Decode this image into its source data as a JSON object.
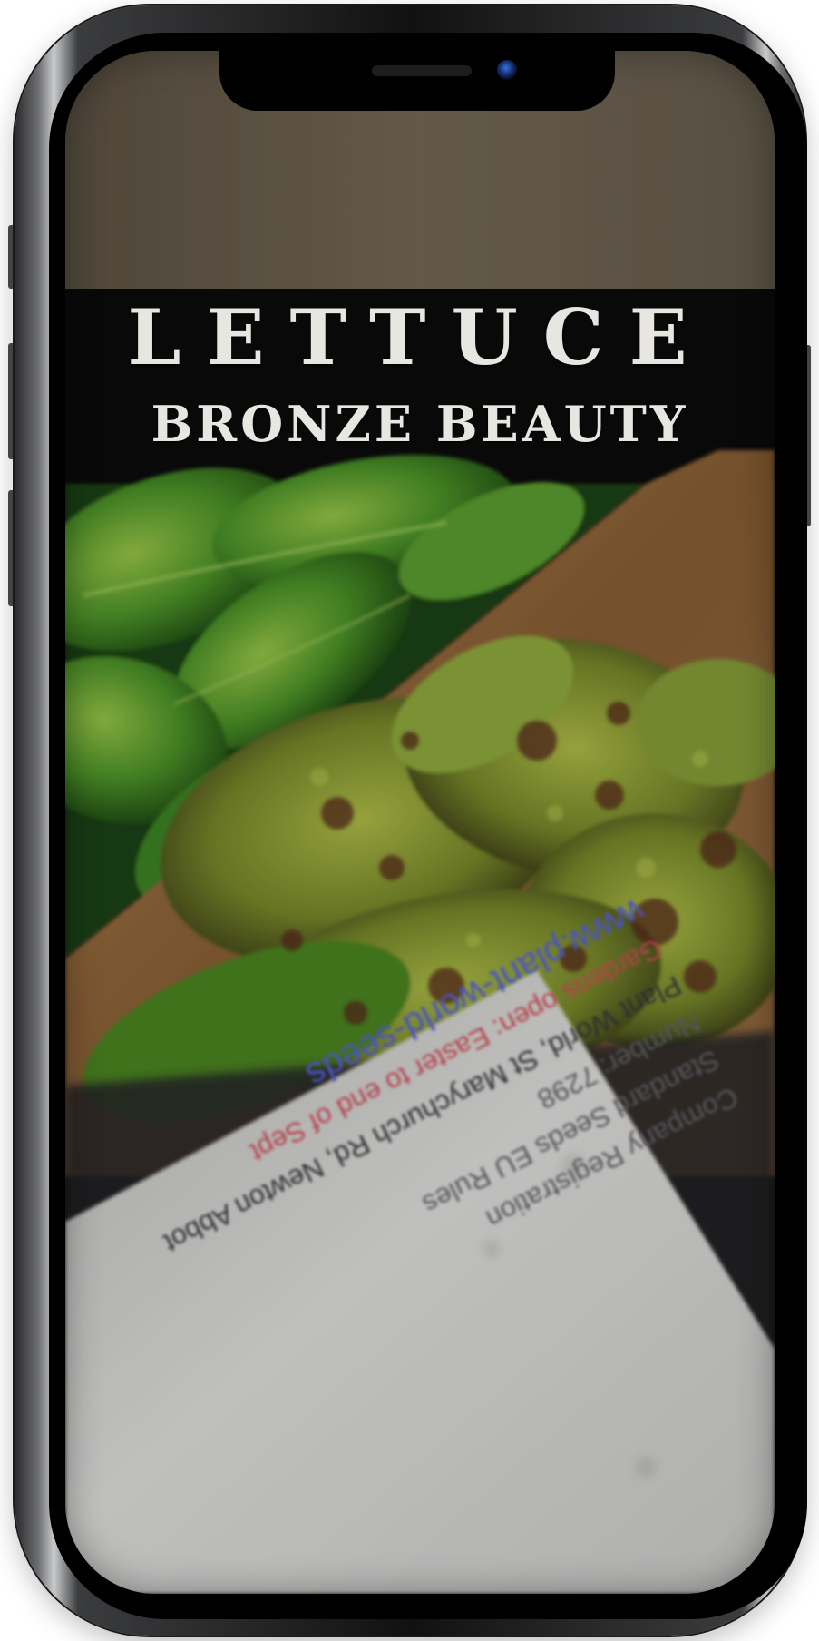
{
  "device": {
    "type": "smartphone",
    "frame_color": "#1b1b1d"
  },
  "photo": {
    "subject": "Lettuce seed packet",
    "packet": {
      "title": "Lettuce",
      "variety": "Bronze Beauty",
      "banner_color": "#0b0b0b"
    },
    "card_lines": [
      {
        "text": "Company Registration",
        "tone": "dark"
      },
      {
        "text": "Standard Seeds EU Rules",
        "tone": "dark"
      },
      {
        "text": "Number: 7298",
        "tone": "dark"
      },
      {
        "text": "Plant World, St Marychurch Rd, Newton Abbot",
        "tone": "dark"
      },
      {
        "text": "Gardens open: Easter to end of Sept",
        "tone": "red"
      },
      {
        "text": "www.plant-world-seeds",
        "tone": "blue"
      }
    ],
    "colors": {
      "leaf_light": "#8fb43a",
      "leaf_dark": "#2f6b1e",
      "bronze_speckle": "#5a2a1e",
      "wood": "#a87a48",
      "card": "#e8e8e6"
    }
  }
}
